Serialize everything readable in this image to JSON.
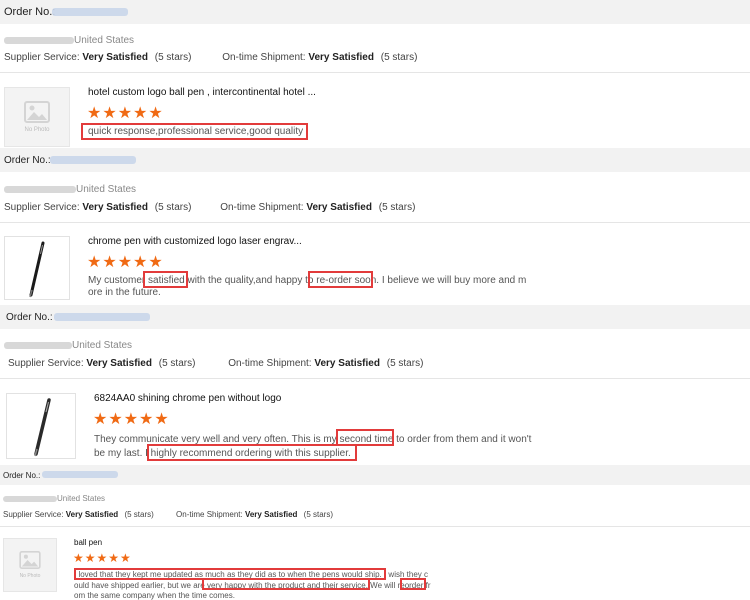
{
  "orders": [
    {
      "order_label": "Order No.:",
      "country": "United States",
      "supplier_label": "Supplier Service:",
      "supplier_value": "Very Satisfied",
      "supplier_stars": "(5 stars)",
      "ontime_label": "On-time Shipment:",
      "ontime_value": "Very Satisfied",
      "ontime_stars": "(5 stars)",
      "product_title": "hotel custom logo ball pen , intercontinental hotel ...",
      "stars": "★★★★★",
      "no_photo": "No Photo",
      "review_lines": [
        "quick response,professional service,good quality"
      ]
    },
    {
      "order_label": "Order No.:",
      "country": "United States",
      "supplier_label": "Supplier Service:",
      "supplier_value": "Very Satisfied",
      "supplier_stars": "(5 stars)",
      "ontime_label": "On-time Shipment:",
      "ontime_value": "Very Satisfied",
      "ontime_stars": "(5 stars)",
      "product_title": "chrome pen with customized logo laser engrav...",
      "stars": "★★★★★",
      "review_lines": [
        "My customer satisfied with the quality,and happy to re-order soon. I believe we will buy more and m",
        "ore in the future."
      ]
    },
    {
      "order_label": "Order No.:",
      "country": "United States",
      "supplier_label": "Supplier Service:",
      "supplier_value": "Very Satisfied",
      "supplier_stars": "(5 stars)",
      "ontime_label": "On-time Shipment:",
      "ontime_value": "Very Satisfied",
      "ontime_stars": "(5 stars)",
      "product_title": "6824AA0 shining chrome pen without logo",
      "stars": "★★★★★",
      "review_lines": [
        "They communicate very well and very often. This is my second time to order from them and it won't",
        "be my last. I highly recommend ordering with this supplier."
      ]
    },
    {
      "order_label": "Order No.:",
      "country": "United States",
      "supplier_label": "Supplier Service:",
      "supplier_value": "Very Satisfied",
      "supplier_stars": "(5 stars)",
      "ontime_label": "On-time Shipment:",
      "ontime_value": "Very Satisfied",
      "ontime_stars": "(5 stars)",
      "product_title": "ball pen",
      "stars": "★★★★★",
      "no_photo": "No Photo",
      "review_lines": [
        "I loved that they kept me updated as much as they did as to when the pens would ship. I wish they c",
        "ould have shipped earlier, but we are very happy with the product and their service. We will reorder fr",
        "om the same company when the time comes."
      ]
    }
  ],
  "colors": {
    "star": "#f06a14",
    "highlight": "#e23b3b",
    "order_bar": "#f2f2f2"
  }
}
